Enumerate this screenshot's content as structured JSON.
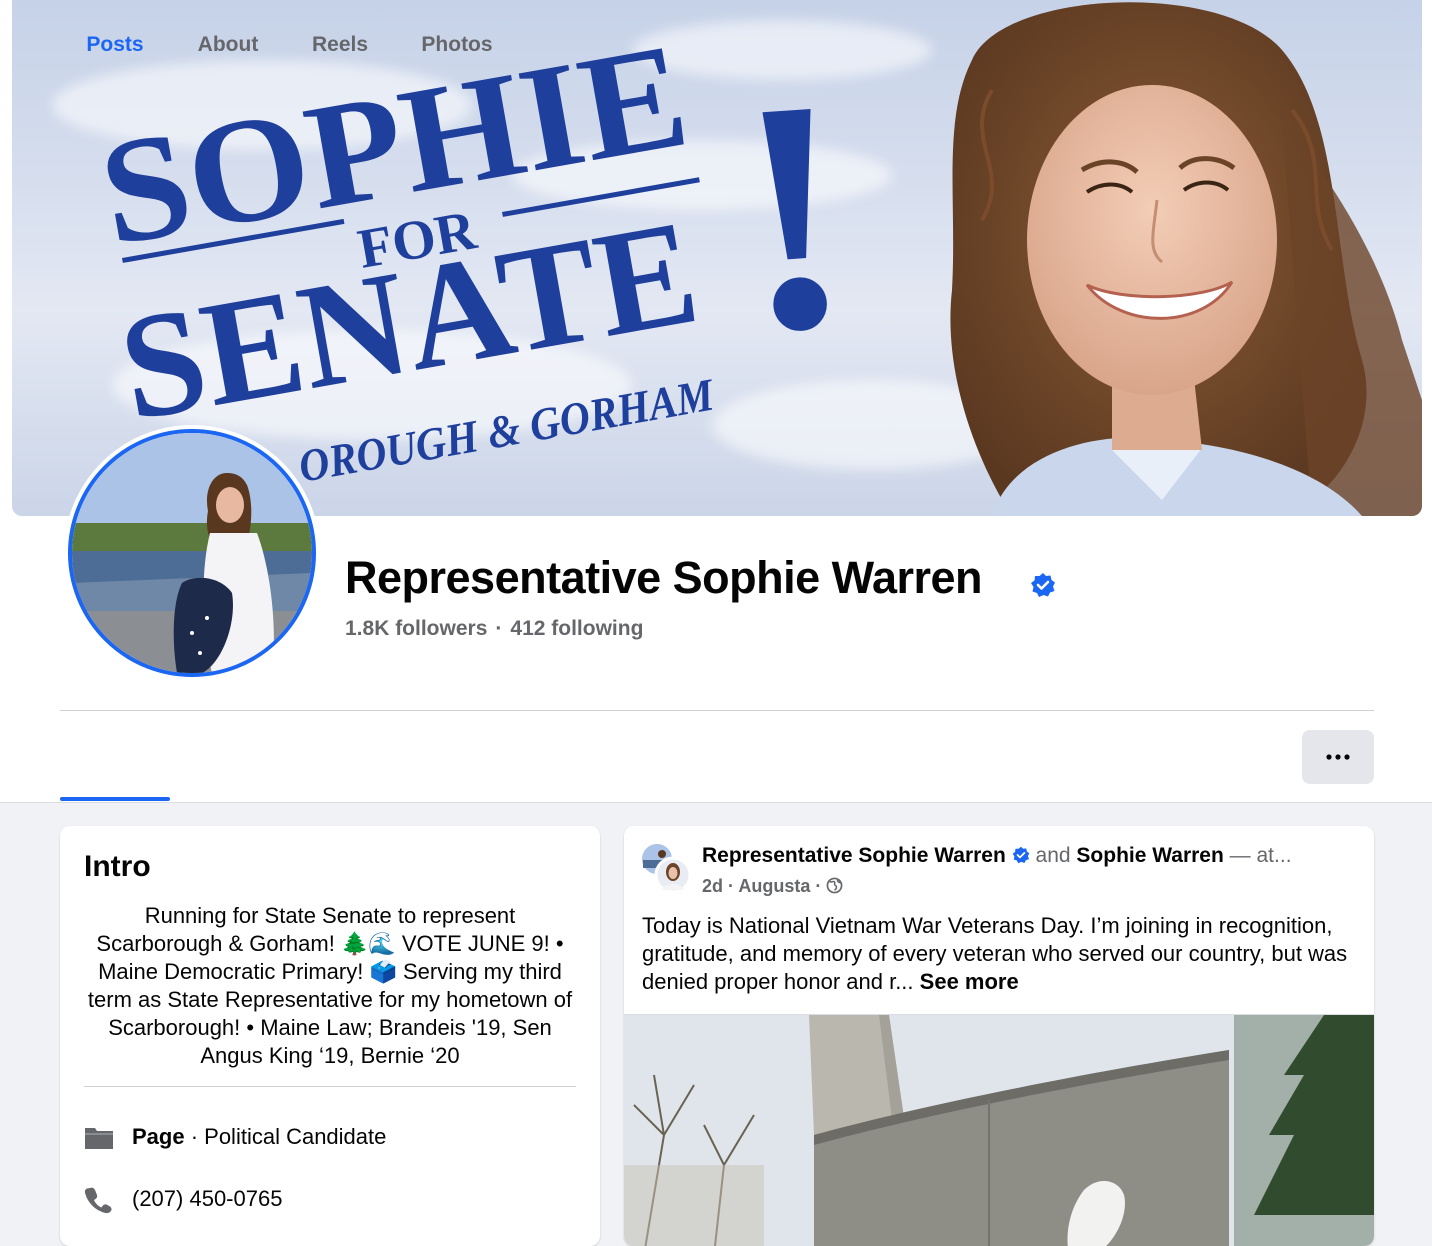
{
  "cover": {
    "logo_lines": [
      "SOPHIE",
      "FOR",
      "SENATE",
      "!",
      "OROUGH & GORHAM"
    ]
  },
  "profile": {
    "name": "Representative Sophie Warren",
    "followers": "1.8K followers",
    "separator": "·",
    "following": "412 following"
  },
  "tabs": [
    {
      "label": "Posts",
      "active": true
    },
    {
      "label": "About",
      "active": false
    },
    {
      "label": "Reels",
      "active": false
    },
    {
      "label": "Photos",
      "active": false
    }
  ],
  "more_button_icon": "ellipsis-icon",
  "intro": {
    "title": "Intro",
    "bio": "Running for State Senate to represent Scarborough & Gorham! 🌲🌊 VOTE JUNE 9! • Maine Democratic Primary! 🗳️ Serving my third term as State Representative for my hometown of Scarborough! • Maine Law; Brandeis '19, Sen Angus King ‘19, Bernie ‘20",
    "category_bold": "Page",
    "category_rest": " · Political Candidate",
    "phone": "(207) 450-0765"
  },
  "post": {
    "author": "Representative Sophie Warren",
    "and_text": "and",
    "coauthor": "Sophie Warren",
    "trailing": "— at...",
    "time": "2d",
    "location": "Augusta",
    "text": "Today is National Vietnam War Veterans Day. I’m joining in recognition, gratitude, and memory of every veteran who served our country, but was denied proper honor and r...",
    "see_more": "See more"
  },
  "colors": {
    "accent": "#1b66f2",
    "cover_text": "#1f3f9c",
    "secondary_text": "#65676b"
  }
}
